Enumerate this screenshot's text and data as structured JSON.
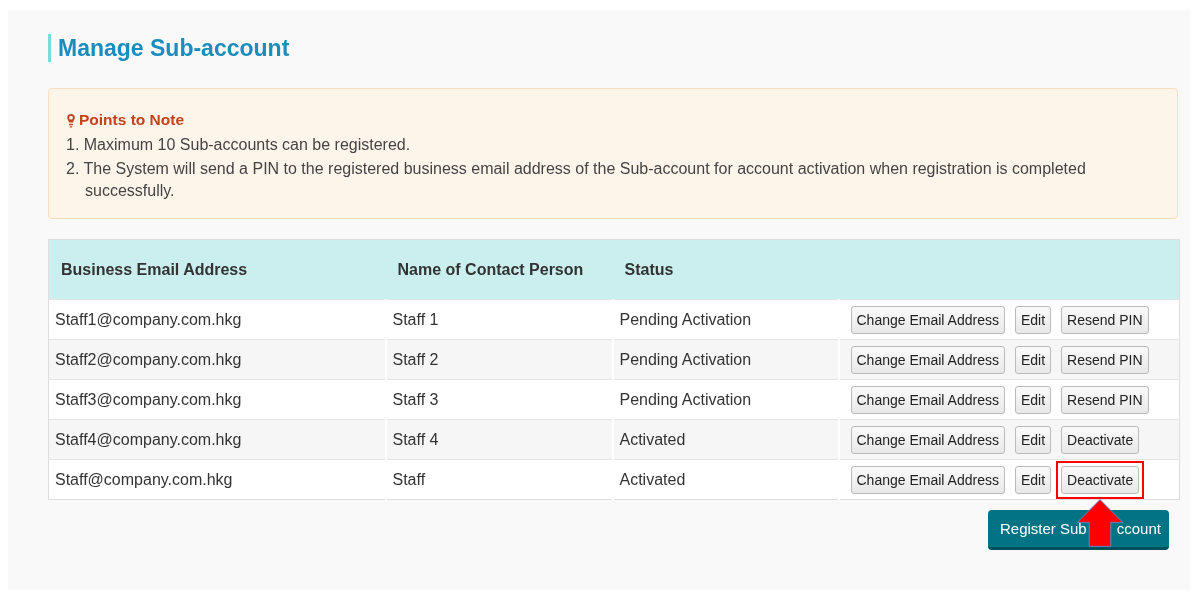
{
  "title": "Manage Sub-account",
  "note": {
    "heading": "Points to Note",
    "items": [
      "1. Maximum 10 Sub-accounts can be registered.",
      "2. The System will send a PIN to the registered business email address of the Sub-account for account activation when registration is completed successfully."
    ]
  },
  "table": {
    "columns": [
      "Business Email Address",
      "Name of Contact Person",
      "Status"
    ],
    "rows": [
      {
        "email": "Staff1@company.com.hkg",
        "name": "Staff 1",
        "status": "Pending Activation",
        "actions": [
          {
            "label": "Change Email Address",
            "highlighted": false
          },
          {
            "label": "Edit",
            "highlighted": false
          },
          {
            "label": "Resend PIN",
            "highlighted": false
          }
        ]
      },
      {
        "email": "Staff2@company.com.hkg",
        "name": "Staff 2",
        "status": "Pending Activation",
        "actions": [
          {
            "label": "Change Email Address",
            "highlighted": false
          },
          {
            "label": "Edit",
            "highlighted": false
          },
          {
            "label": "Resend PIN",
            "highlighted": false
          }
        ]
      },
      {
        "email": "Staff3@company.com.hkg",
        "name": "Staff 3",
        "status": "Pending Activation",
        "actions": [
          {
            "label": "Change Email Address",
            "highlighted": false
          },
          {
            "label": "Edit",
            "highlighted": false
          },
          {
            "label": "Resend PIN",
            "highlighted": false
          }
        ]
      },
      {
        "email": "Staff4@company.com.hkg",
        "name": "Staff 4",
        "status": "Activated",
        "actions": [
          {
            "label": "Change Email Address",
            "highlighted": false
          },
          {
            "label": "Edit",
            "highlighted": false
          },
          {
            "label": "Deactivate",
            "highlighted": false
          }
        ]
      },
      {
        "email": "Staff@company.com.hkg",
        "name": "Staff",
        "status": "Activated",
        "actions": [
          {
            "label": "Change Email Address",
            "highlighted": false
          },
          {
            "label": "Edit",
            "highlighted": false
          },
          {
            "label": "Deactivate",
            "highlighted": true
          }
        ]
      }
    ]
  },
  "register_button": {
    "label_parts": [
      "Register Sub",
      "ccount"
    ]
  }
}
